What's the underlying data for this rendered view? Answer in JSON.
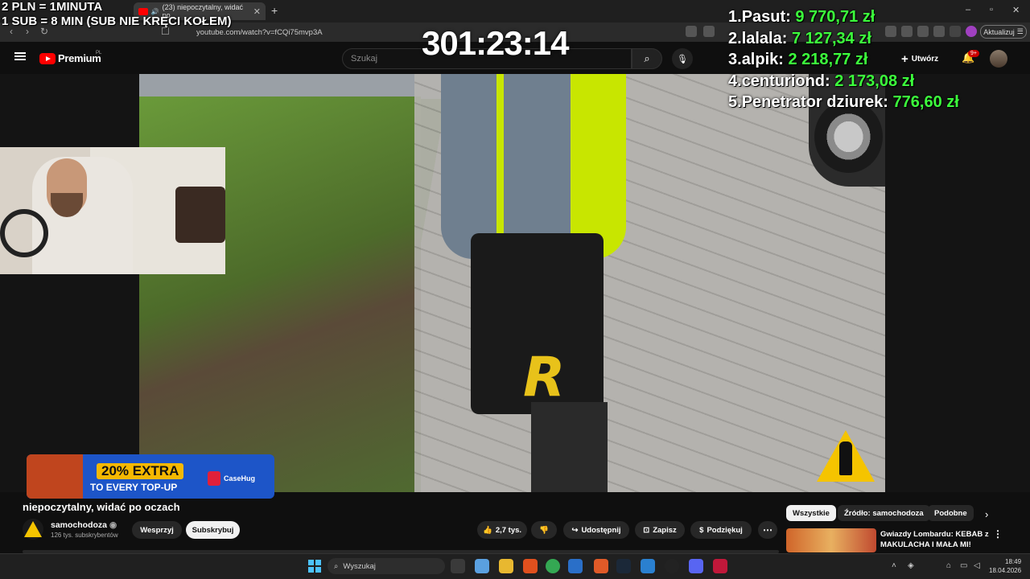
{
  "browser": {
    "tab_title": "(23) niepoczytalny, widać po",
    "url": "youtube.com/watch?v=fCQi75mvp3A",
    "update_button": "Aktualizuj"
  },
  "youtube": {
    "logo_text": "Premium",
    "region": "PL",
    "search_placeholder": "Szukaj",
    "create_label": "Utwórz",
    "notification_count": "9+"
  },
  "overlay": {
    "rule_line1": "2 PLN = 1MINUTA",
    "rule_line2": "1 SUB = 8 MIN (SUB NIE KRĘCI KOŁEM)",
    "timer": "301:23:14",
    "leaderboard": [
      {
        "rank": "1.",
        "name": "Pasut:",
        "amount": "9 770,71 zł"
      },
      {
        "rank": "2.",
        "name": "lalala:",
        "amount": "7 127,34 zł"
      },
      {
        "rank": "3.",
        "name": "alpik:",
        "amount": "2 218,77 zł"
      },
      {
        "rank": "4.",
        "name": "centuriond:",
        "amount": "2 173,08 zł"
      },
      {
        "rank": "5.",
        "name": "Penetrator dziurek:",
        "amount": "776,60 zł"
      }
    ]
  },
  "ad": {
    "headline": "20% EXTRA",
    "subline": "TO EVERY TOP-UP",
    "brand": "CaseHug"
  },
  "video": {
    "title": "niepoczytalny, widać po oczach",
    "channel": "samochodoza",
    "subscribers": "126 tys. subskrybentów",
    "support_label": "Wesprzyj",
    "subscribe_label": "Subskrybuj",
    "likes": "2,7 tys.",
    "share_label": "Udostępnij",
    "save_label": "Zapisz",
    "thanks_label": "Podziękuj"
  },
  "recommendations": {
    "chips": [
      "Wszystkie",
      "Źródło: samochodoza",
      "Podobne"
    ],
    "first_title": "Gwiazdy Lombardu: KEBAB z MAKULACHA I MAŁA MI!"
  },
  "taskbar": {
    "search_placeholder": "Wyszukaj",
    "time": "18:49",
    "date": "18.04.2026"
  }
}
